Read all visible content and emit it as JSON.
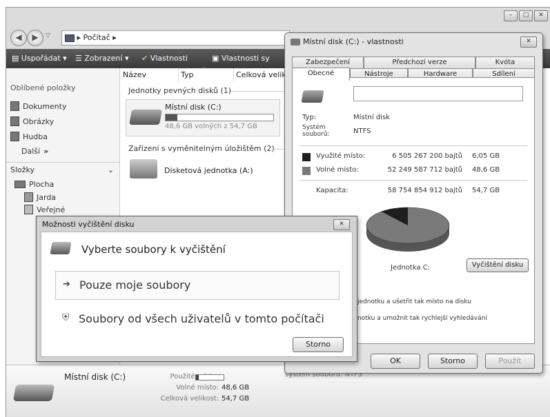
{
  "explorer": {
    "address": [
      "Počítač"
    ],
    "toolbar": [
      "Uspořádat",
      "Zobrazení",
      "Vlastnosti",
      "Vlastnosti sy"
    ],
    "favorites_header": "Oblíbené položky",
    "favorites": [
      "Dokumenty",
      "Obrázky",
      "Hudba"
    ],
    "more": "Další",
    "folders_header": "Složky",
    "folders": [
      "Plocha",
      "Jarda",
      "Veřejné"
    ],
    "columns": [
      "Název",
      "Typ",
      "Celková velik"
    ],
    "group_hdd": "Jednotky pevných disků (1)",
    "drive_c_name": "Místní disk (C:)",
    "drive_c_free": "48,6 GB volných z 54,7 GB",
    "drive_c_used_fraction": 0.11,
    "group_removable": "Zařízení s vyměnitelným úložištěm (2)",
    "drive_a_name": "Disketová jednotka (A:)",
    "details": {
      "name": "Místní disk (C:)",
      "used_label": "Použité místo:",
      "free_label": "Volné místo:",
      "free_value": "48,6 GB",
      "total_label": "Celková velikost:",
      "total_value": "54,7 GB",
      "fs_partial": "systém souborů: NTFS"
    }
  },
  "properties": {
    "title": "Místní disk (C:) - vlastnosti",
    "tabs_row1": [
      "Zabezpečení",
      "Předchozí verze",
      "Kvóta"
    ],
    "tabs_row2": [
      "Obecné",
      "Nástroje",
      "Hardware",
      "Sdílení"
    ],
    "type_label": "Typ:",
    "type_value": "Místní disk",
    "fs_label": "Systém souborů:",
    "fs_value": "NTFS",
    "used_label": "Využité místo:",
    "used_bytes": "6 505 267 200 bajtů",
    "used_gb": "6,05 GB",
    "free_label": "Volné místo:",
    "free_bytes": "52 249 587 712 bajtů",
    "free_gb": "48,6 GB",
    "capacity_label": "Kapacita:",
    "capacity_bytes": "58 754 854 912 bajtů",
    "capacity_gb": "54,7 GB",
    "drive_label": "Jednotka C:",
    "cleanup_button": "Vyčištění disku",
    "compress_text": "jednotku a ušetřit tak místo na disku",
    "index_text": "notku a umožnit tak rychlejší vyhledávání",
    "ok": "OK",
    "cancel": "Storno",
    "apply": "Použít",
    "used_fraction": 0.11,
    "used_color": "#1e1e1e",
    "free_color": "#7a7a7a"
  },
  "cleanup_dialog": {
    "title": "Možnosti vyčištění disku",
    "heading": "Vyberte soubory k vyčištění",
    "option1": "Pouze moje soubory",
    "option2": "Soubory od všech uživatelů v tomto počítači",
    "cancel": "Storno"
  }
}
